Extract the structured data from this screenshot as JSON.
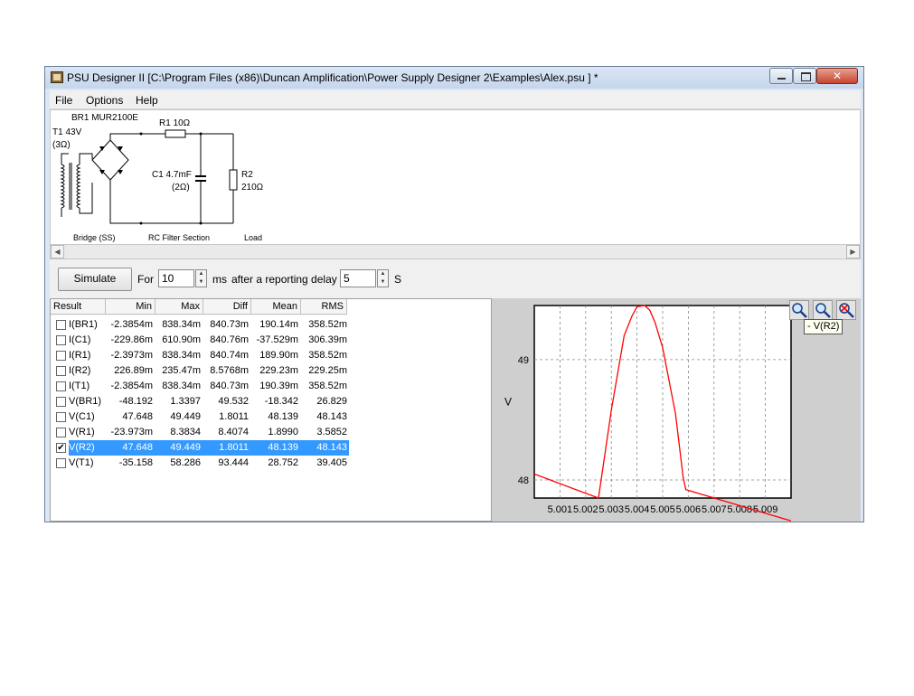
{
  "window": {
    "title": "PSU Designer II  [C:\\Program Files (x86)\\Duncan Amplification\\Power Supply Designer 2\\Examples\\Alex.psu ] *",
    "menu": [
      "File",
      "Options",
      "Help"
    ]
  },
  "schematic": {
    "bridge_name": "BR1 MUR2100E",
    "transformer": "T1 43V",
    "transformer_res": "(3Ω)",
    "r1": "R1 10Ω",
    "c1": "C1 4.7mF",
    "c1_res": "(2Ω)",
    "r2": "R2",
    "r2_val": "210Ω",
    "section_bridge": "Bridge (SS)",
    "section_filter": "RC Filter Section",
    "section_load": "Load"
  },
  "controls": {
    "simulate_label": "Simulate",
    "for_label": "For",
    "duration_value": "10",
    "ms_label": "ms",
    "delay_label": "after a reporting delay of",
    "delay_value": "5",
    "s_label": "S"
  },
  "results": {
    "columns": [
      "Result",
      "Min",
      "Max",
      "Diff",
      "Mean",
      "RMS"
    ],
    "rows": [
      {
        "checked": false,
        "selected": false,
        "name": "I(BR1)",
        "min": "-2.3854m",
        "max": "838.34m",
        "diff": "840.73m",
        "mean": "190.14m",
        "rms": "358.52m"
      },
      {
        "checked": false,
        "selected": false,
        "name": "I(C1)",
        "min": "-229.86m",
        "max": "610.90m",
        "diff": "840.76m",
        "mean": "-37.529m",
        "rms": "306.39m"
      },
      {
        "checked": false,
        "selected": false,
        "name": "I(R1)",
        "min": "-2.3973m",
        "max": "838.34m",
        "diff": "840.74m",
        "mean": "189.90m",
        "rms": "358.52m"
      },
      {
        "checked": false,
        "selected": false,
        "name": "I(R2)",
        "min": "226.89m",
        "max": "235.47m",
        "diff": "8.5768m",
        "mean": "229.23m",
        "rms": "229.25m"
      },
      {
        "checked": false,
        "selected": false,
        "name": "I(T1)",
        "min": "-2.3854m",
        "max": "838.34m",
        "diff": "840.73m",
        "mean": "190.39m",
        "rms": "358.52m"
      },
      {
        "checked": false,
        "selected": false,
        "name": "V(BR1)",
        "min": "-48.192",
        "max": "1.3397",
        "diff": "49.532",
        "mean": "-18.342",
        "rms": "26.829"
      },
      {
        "checked": false,
        "selected": false,
        "name": "V(C1)",
        "min": "47.648",
        "max": "49.449",
        "diff": "1.8011",
        "mean": "48.139",
        "rms": "48.143"
      },
      {
        "checked": false,
        "selected": false,
        "name": "V(R1)",
        "min": "-23.973m",
        "max": "8.3834",
        "diff": "8.4074",
        "mean": "1.8990",
        "rms": "3.5852"
      },
      {
        "checked": true,
        "selected": true,
        "name": "V(R2)",
        "min": "47.648",
        "max": "49.449",
        "diff": "1.8011",
        "mean": "48.139",
        "rms": "48.143"
      },
      {
        "checked": false,
        "selected": false,
        "name": "V(T1)",
        "min": "-35.158",
        "max": "58.286",
        "diff": "93.444",
        "mean": "28.752",
        "rms": "39.405"
      }
    ]
  },
  "chart_tooltip": "- V(R2)",
  "colors": {
    "series": "#ff0000",
    "selection": "#3399ff",
    "plot_bg": "#cfcfcf"
  },
  "chart_data": {
    "type": "line",
    "series": [
      {
        "name": "V(R2)",
        "x": [
          5.0,
          5.0025,
          5.003,
          5.0035,
          5.0038,
          5.004,
          5.0043,
          5.0045,
          5.0047,
          5.005,
          5.0055,
          5.0058,
          5.0059,
          5.01
        ],
        "y": [
          48.05,
          47.85,
          48.58,
          49.2,
          49.36,
          49.44,
          49.45,
          49.41,
          49.31,
          49.1,
          48.55,
          48.02,
          47.92,
          47.66
        ]
      }
    ],
    "x_ticks": [
      "5.001",
      "5.002",
      "5.003",
      "5.004",
      "5.005",
      "5.006",
      "5.007",
      "5.008",
      "5.009"
    ],
    "y_ticks": [
      "48",
      "49"
    ],
    "ylabel": "V",
    "xlim": [
      5.0,
      5.01
    ],
    "ylim": [
      47.85,
      49.45
    ],
    "grid": true
  }
}
